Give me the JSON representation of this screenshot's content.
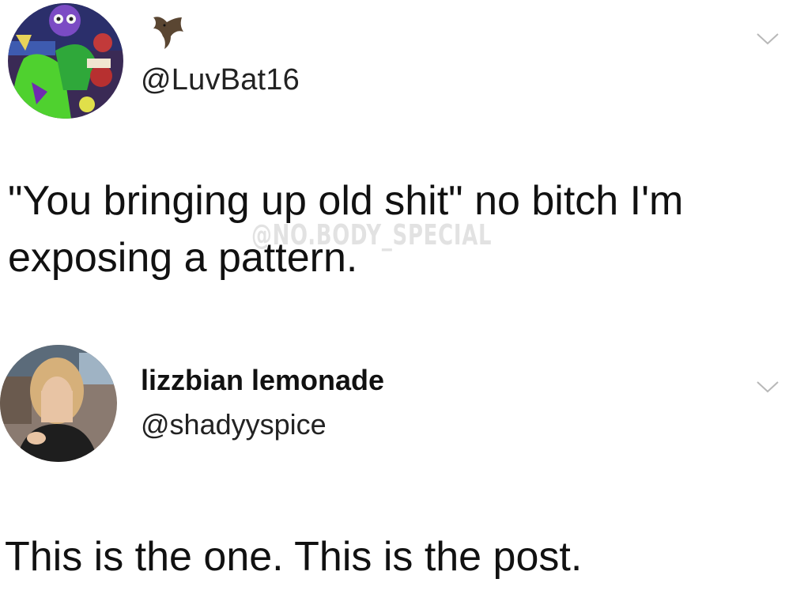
{
  "tweet1": {
    "handle": "@LuvBat16",
    "text": "\"You bringing up old shit\" no bitch I'm exposing a pattern.",
    "avatar_icon": "cartoon-avatar",
    "emoji": "bat-emoji",
    "menu_icon": "chevron-down-icon"
  },
  "watermark": "@NO.BODY_SPECIAL",
  "tweet2": {
    "name": "lizzbian lemonade",
    "handle": "@shadyyspice",
    "text": "This is the one. This is the post.",
    "avatar_icon": "photo-avatar",
    "menu_icon": "chevron-down-icon"
  },
  "colors": {
    "background": "#ffffff",
    "text": "#111111",
    "chevron": "#b8b8b8"
  }
}
